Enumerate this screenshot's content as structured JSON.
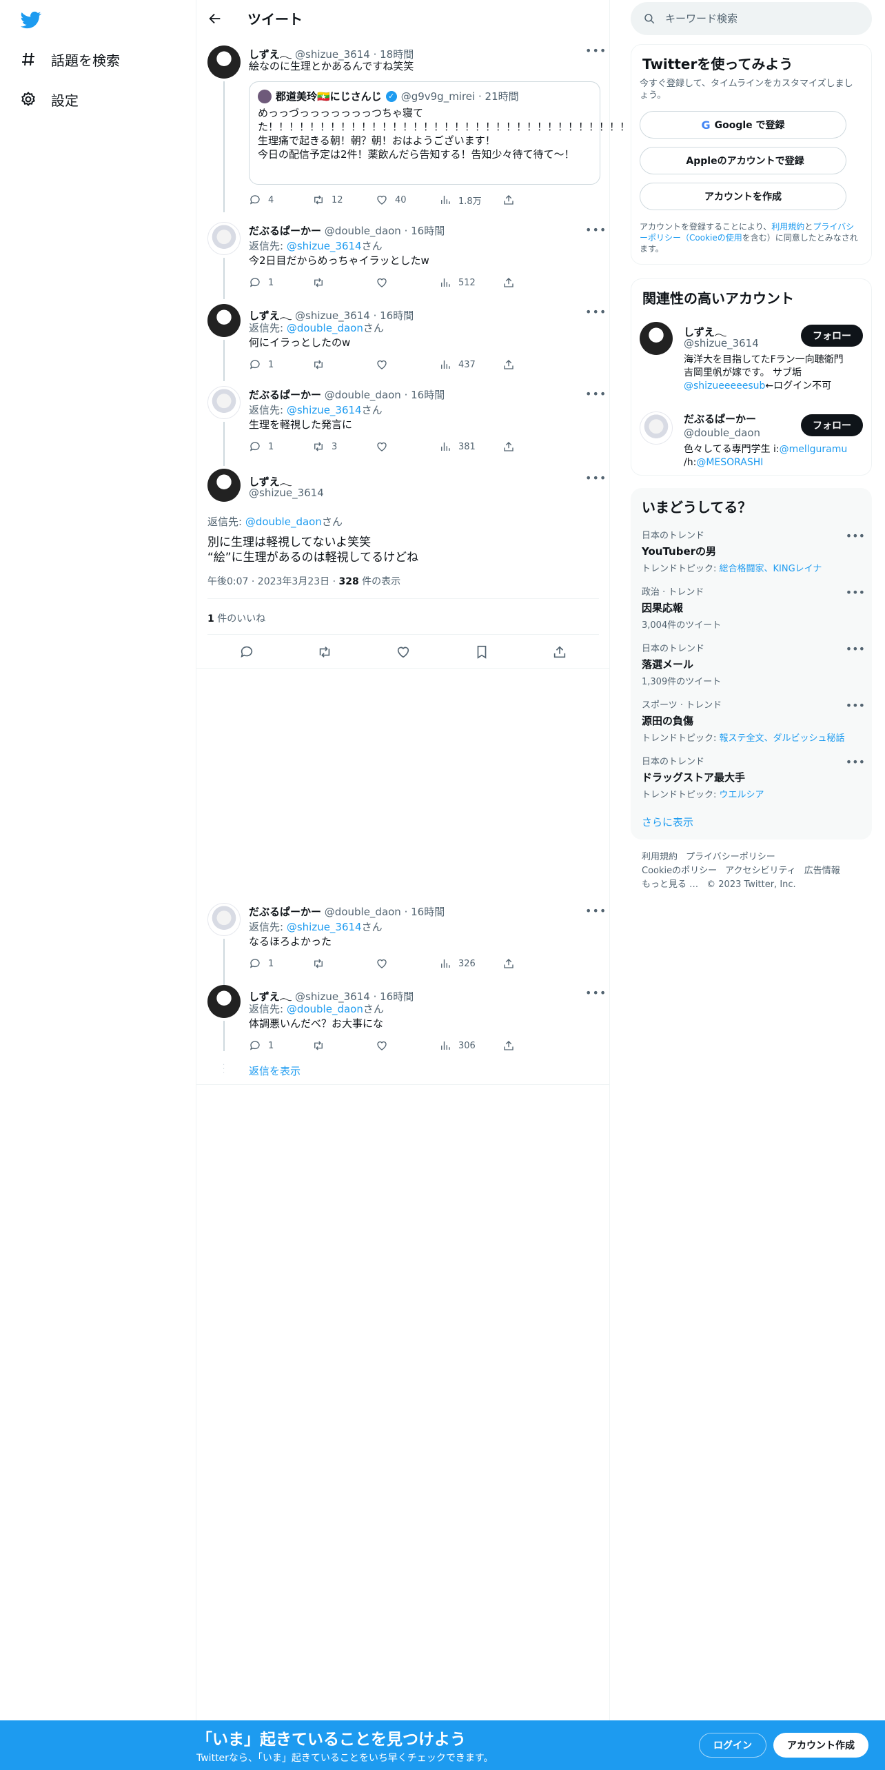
{
  "nav": {
    "search_label": "話題を検索",
    "settings_label": "設定"
  },
  "header": {
    "title": "ツイート"
  },
  "tweets": [
    {
      "name": "しずえ𓂃",
      "handle": "@shizue_3614",
      "time": "18時間",
      "text": "絵なのに生理とかあるんですね笑笑",
      "quote": {
        "name": "郡道美玲🇲🇲にじさんじ",
        "handle": "@g9v9g_mirei",
        "time": "21時間",
        "text": "めっっづっっっっっっっつちゃ寝てた！！！！！！！！！！！！！！！！！！！！！！！！！！！！！！！！！！！！！！！！！！！！！！！！！！！生理痛で起きる朝！朝？朝！おはようございます！\n今日の配信予定は2件！薬飲んだら告知する！告知少々待て待て〜！"
      },
      "reply_count": "4",
      "retweet_count": "12",
      "like_count": "40",
      "view_count": "1.8万"
    },
    {
      "name": "だぶるぱーかー",
      "handle": "@double_daon",
      "time": "16時間",
      "reply_prefix": "返信先: ",
      "reply_to": "@shizue_3614",
      "reply_suffix": "さん",
      "text": "今2日目だからめっちゃイラッとしたw",
      "reply_count": "1",
      "retweet_count": "",
      "like_count": "",
      "view_count": "512"
    },
    {
      "name": "しずえ𓂃",
      "handle": "@shizue_3614",
      "time": "16時間",
      "reply_prefix": "返信先: ",
      "reply_to": "@double_daon",
      "reply_suffix": "さん",
      "text": "何にイラっとしたのw",
      "reply_count": "1",
      "retweet_count": "",
      "like_count": "",
      "view_count": "437"
    },
    {
      "name": "だぶるぱーかー",
      "handle": "@double_daon",
      "time": "16時間",
      "reply_prefix": "返信先: ",
      "reply_to": "@shizue_3614",
      "reply_suffix": "さん",
      "text": "生理を軽視した発言に",
      "reply_count": "1",
      "retweet_count": "3",
      "like_count": "",
      "view_count": "381"
    }
  ],
  "focus": {
    "name": "しずえ𓂃",
    "handle": "@shizue_3614",
    "reply_prefix": "返信先: ",
    "reply_to": "@double_daon",
    "reply_suffix": "さん",
    "text1": "別に生理は軽視してないよ笑笑",
    "text2": "“絵”に生理があるのは軽視してるけどね",
    "timestamp": "午後0:07 · 2023年3月23日 · ",
    "views": "328",
    "views_suffix": " 件の表示",
    "likes": "1",
    "likes_suffix": " 件のいいね"
  },
  "later_tweets": [
    {
      "name": "だぶるぱーかー",
      "handle": "@double_daon",
      "time": "16時間",
      "reply_prefix": "返信先: ",
      "reply_to": "@shizue_3614",
      "reply_suffix": "さん",
      "text": "なるほろよかった",
      "reply_count": "1",
      "view_count": "326"
    },
    {
      "name": "しずえ𓂃",
      "handle": "@shizue_3614",
      "time": "16時間",
      "reply_prefix": "返信先: ",
      "reply_to": "@double_daon",
      "reply_suffix": "さん",
      "text": "体調悪いんだべ？お大事にな",
      "reply_count": "1",
      "view_count": "306"
    }
  ],
  "show_replies": "返信を表示",
  "sidebar": {
    "search_placeholder": "キーワード検索",
    "signup": {
      "title": "Twitterを使ってみよう",
      "desc": "今すぐ登録して、タイムラインをカスタマイズしましょう。",
      "google": "Google で登録",
      "apple": "Appleのアカウントで登録",
      "create": "アカウントを作成",
      "legal_pre": "アカウントを登録することにより、",
      "legal_terms": "利用規約",
      "legal_and": "と",
      "legal_privacy": "プライバシーポリシー（Cookieの使用",
      "legal_post": "を含む）に同意したとみなされます。"
    },
    "related": {
      "title": "関連性の高いアカウント",
      "accounts": [
        {
          "name": "しずえ𓂃",
          "handle": "@shizue_3614",
          "bio1": "海洋大を目指してたFラン一向聴衛門",
          "bio2": "吉岡里帆が嫁です。 サブ垢",
          "bio_link": "@shizueeeeesub",
          "bio3": "←ログイン不可",
          "follow": "フォロー"
        },
        {
          "name": "だぶるぱーかー",
          "handle": "@double_daon",
          "bio1": "色々してる専門学生 i:",
          "bio_link": "@mellguramu",
          "bio2": "/h:",
          "bio_link2": "@MESORASHI",
          "follow": "フォロー"
        }
      ]
    },
    "trends": {
      "title": "いまどうしてる？",
      "items": [
        {
          "meta": "日本のトレンド",
          "name": "YouTuberの男",
          "sub_prefix": "トレンドトピック: ",
          "sub_link": "総合格闘家、KINGレイナ"
        },
        {
          "meta": "政治 · トレンド",
          "name": "因果応報",
          "sub": "3,004件のツイート"
        },
        {
          "meta": "日本のトレンド",
          "name": "落選メール",
          "sub": "1,309件のツイート"
        },
        {
          "meta": "スポーツ · トレンド",
          "name": "源田の負傷",
          "sub_prefix": "トレンドトピック: ",
          "sub_link": "報ステ全文、ダルビッシュ秘話"
        },
        {
          "meta": "日本のトレンド",
          "name": "ドラッグストア最大手",
          "sub_prefix": "トレンドトピック: ",
          "sub_link": "ウエルシア"
        }
      ],
      "show_more": "さらに表示"
    },
    "footer": [
      "利用規約",
      "プライバシーポリシー",
      "Cookieのポリシー",
      "アクセシビリティ",
      "広告情報",
      "もっと見る …",
      "© 2023 Twitter, Inc."
    ]
  },
  "bottom_bar": {
    "title": "「いま」起きていることを見つけよう",
    "subtitle": "Twitterなら、「いま」起きていることをいち早くチェックできます。",
    "login": "ログイン",
    "signup": "アカウント作成"
  },
  "colors": {
    "accent": "#1d9bf0",
    "text": "#0f1419",
    "muted": "#536471"
  }
}
